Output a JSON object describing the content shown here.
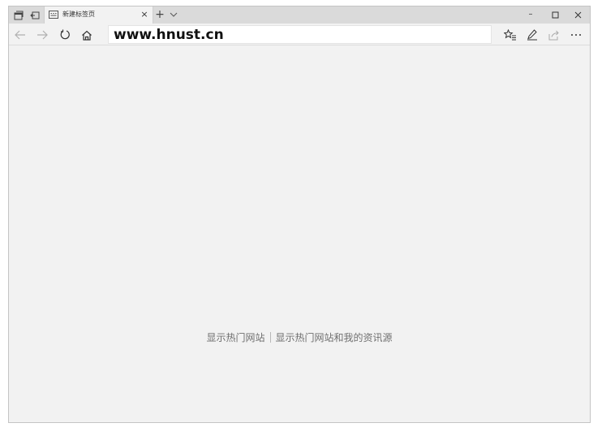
{
  "tab": {
    "title": "新建标签页",
    "close_glyph": "×",
    "new_tab_glyph": "+"
  },
  "window_controls": {
    "minimize": "–"
  },
  "address_bar": {
    "value": "www.hnust.cn"
  },
  "content": {
    "show_top_sites": "显示热门网站",
    "show_top_sites_and_feed": "显示热门网站和我的资讯源"
  },
  "colors": {
    "titlebar": "#dadada",
    "page_background": "#f2f2f2",
    "address_bar": "#ffffff"
  },
  "icons": [
    "tab-preview-icon",
    "set-tabs-aside-icon",
    "new-tab-page-icon",
    "chevron-down-icon",
    "minimize-icon",
    "maximize-icon",
    "close-window-icon",
    "back-arrow-icon",
    "forward-arrow-icon",
    "refresh-icon",
    "home-icon",
    "favorites-hub-icon",
    "web-note-pen-icon",
    "share-icon",
    "more-dots-icon"
  ]
}
